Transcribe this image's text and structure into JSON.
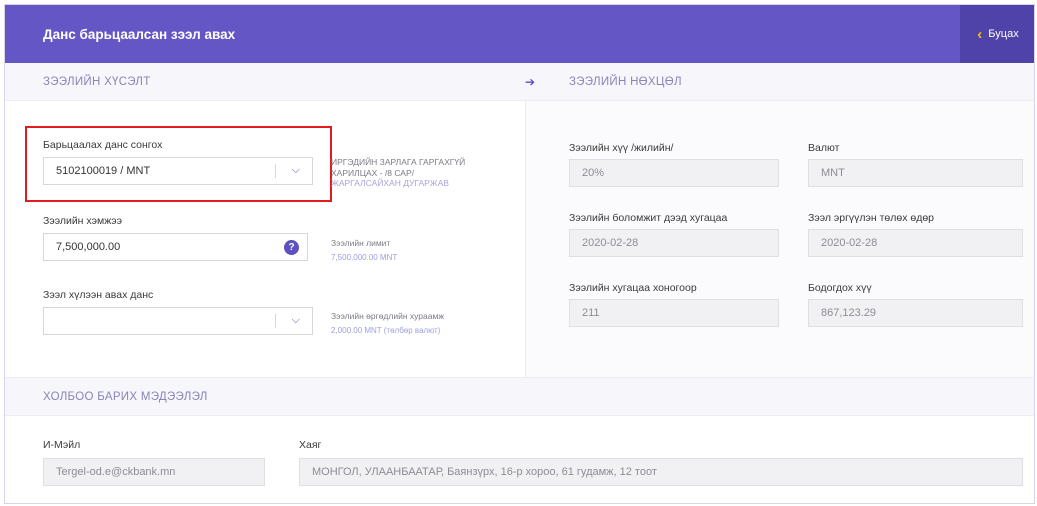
{
  "header": {
    "title": "Данс барьцаалсан зээл авах",
    "back_label": "Буцах"
  },
  "sections": {
    "request": "ЗЭЭЛИЙН ХҮСЭЛТ",
    "terms": "ЗЭЭЛИЙН НӨХЦӨЛ",
    "contact": "ХОЛБОО БАРИХ МЭДЭЭЛЭЛ"
  },
  "request": {
    "collateral_label": "Барьцаалах данс сонгох",
    "collateral_value": "5102100019 / MNT",
    "collateral_info_line1": "ИРГЭДИЙН ЗАРЛАГА ГАРГАХГҮЙ",
    "collateral_info_line2": "ХАРИЛЦАХ - /8 САР/",
    "collateral_info_name": "ЖАРГАЛСАЙХАН ДУГАРЖАВ",
    "amount_label": "Зээлийн хэмжээ",
    "amount_value": "7,500,000.00",
    "limit_label": "Зээлийн лимит",
    "limit_value": "7,500,000.00 MNT",
    "receive_label": "Зээл хүлээн авах данс",
    "receive_value": "",
    "fee_label": "Зээлийн өргөдлийн хураамж",
    "fee_value": "2,000.00 MNT (төлбөр валют)"
  },
  "terms": {
    "rate_label": "Зээлийн хүү /жилийн/",
    "rate_value": "20%",
    "currency_label": "Валют",
    "currency_value": "MNT",
    "max_term_label": "Зээлийн боломжит дээд хугацаа",
    "max_term_value": "2020-02-28",
    "repay_label": "Зээл эргүүлэн төлөх өдөр",
    "repay_value": "2020-02-28",
    "days_label": "Зээлийн хугацаа хоногоор",
    "days_value": "211",
    "interest_label": "Бодогдох хүү",
    "interest_value": "867,123.29"
  },
  "contact": {
    "email_label": "И-Мэйл",
    "email_value": "Tergel-od.e@ckbank.mn",
    "address_label": "Хаяг",
    "address_value": "МОНГОЛ, УЛААНБААТАР, Баянзүрх, 16-р хороо, 61 гудамж, 12 тоот"
  },
  "colors": {
    "header": "#6556c6",
    "accent": "#5b4fc0",
    "back_icon": "#f2c200",
    "highlight": "#e21c1c"
  }
}
